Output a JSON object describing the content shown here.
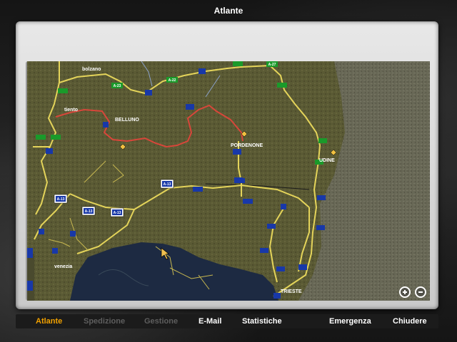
{
  "window": {
    "title": "Atlante"
  },
  "map": {
    "cities": [
      {
        "id": "bolzano",
        "name": "bolzano"
      },
      {
        "id": "trento",
        "name": "tiento"
      },
      {
        "id": "belluno",
        "name": "BELLUNO"
      },
      {
        "id": "pordenone",
        "name": "PORDENONE"
      },
      {
        "id": "udine",
        "name": "UDINE"
      },
      {
        "id": "venezia",
        "name": "venezia"
      },
      {
        "id": "trieste",
        "name": "TRIESTE"
      }
    ],
    "road_shields": {
      "a13_upper": "A-13",
      "a13_left": "A-13",
      "a13_mid": "A-13",
      "a13_right": "A-13",
      "a22": "A-22",
      "a23": "A-23",
      "a27": "A-27"
    },
    "colors": {
      "land": "#5c5c36",
      "sea": "#1c2b44",
      "road": "#e8d85a",
      "highway_red": "#d8463a",
      "border": "#1a1a1a"
    }
  },
  "zoom": {
    "in_icon": "zoom-in-icon",
    "out_icon": "zoom-out-icon"
  },
  "nav": {
    "atlante": "Atlante",
    "spedizione": "Spedizione",
    "gestione": "Gestione",
    "email": "E-Mail",
    "statistiche": "Statistiche",
    "emergenza": "Emergenza",
    "chiudere": "Chiudere"
  }
}
